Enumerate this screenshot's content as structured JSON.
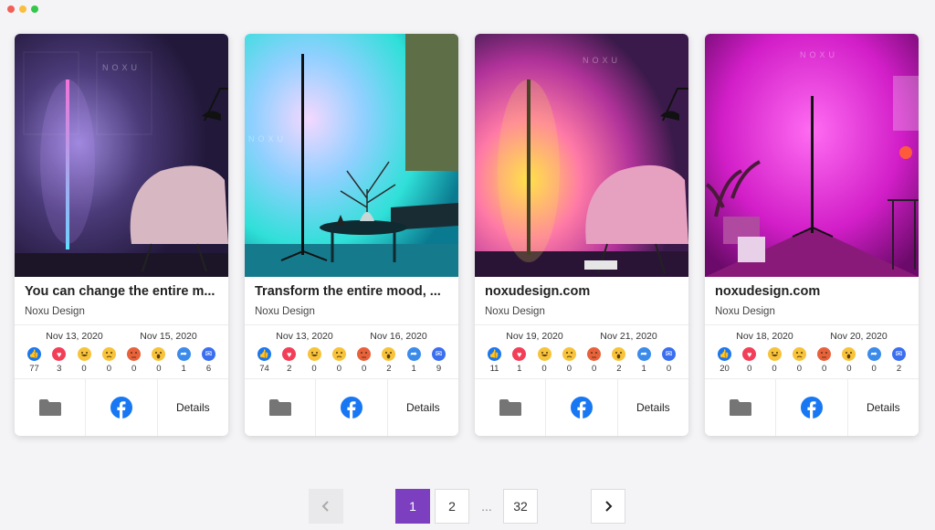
{
  "window": {
    "dots": [
      "#f25f58",
      "#fbbe3c",
      "#32c84a"
    ]
  },
  "cards": [
    {
      "title": "You can change the entire m...",
      "author": "Noxu Design",
      "date_start": "Nov 13, 2020",
      "date_end": "Nov 15, 2020",
      "counts": [
        "77",
        "3",
        "0",
        "0",
        "0",
        "0",
        "1",
        "6"
      ],
      "details_label": "Details",
      "watermark": "NOXU"
    },
    {
      "title": "Transform the entire mood, ...",
      "author": "Noxu Design",
      "date_start": "Nov 13, 2020",
      "date_end": "Nov 16, 2020",
      "counts": [
        "74",
        "2",
        "0",
        "0",
        "0",
        "2",
        "1",
        "9"
      ],
      "details_label": "Details",
      "watermark": "NOXU"
    },
    {
      "title": "noxudesign.com",
      "author": "Noxu Design",
      "date_start": "Nov 19, 2020",
      "date_end": "Nov 21, 2020",
      "counts": [
        "11",
        "1",
        "0",
        "0",
        "0",
        "2",
        "1",
        "0"
      ],
      "details_label": "Details",
      "watermark": "NOXU"
    },
    {
      "title": "noxudesign.com",
      "author": "Noxu Design",
      "date_start": "Nov 18, 2020",
      "date_end": "Nov 20, 2020",
      "counts": [
        "20",
        "0",
        "0",
        "0",
        "0",
        "0",
        "0",
        "2"
      ],
      "details_label": "Details",
      "watermark": "NOXU"
    }
  ],
  "reaction_icons": [
    "like-icon",
    "love-icon",
    "haha-icon",
    "sad-icon",
    "angry-icon",
    "wow-icon",
    "share-icon",
    "messenger-icon"
  ],
  "colors": {
    "accent": "#7b3fbf",
    "facebook": "#1877f2",
    "folder": "#757575"
  },
  "pagination": {
    "pages": [
      "1",
      "2",
      "32"
    ],
    "ellipsis": "...",
    "current": "1"
  }
}
